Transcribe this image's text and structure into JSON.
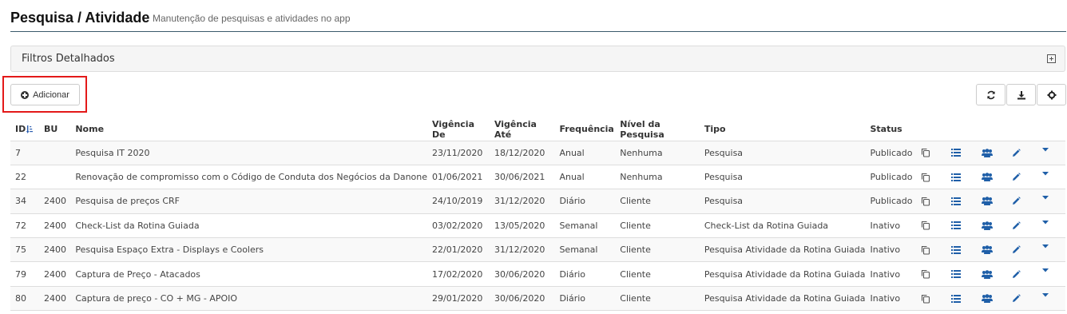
{
  "header": {
    "title": "Pesquisa / Atividade",
    "subtitle": "Manutenção de pesquisas e atividades no app"
  },
  "filters": {
    "title": "Filtros Detalhados"
  },
  "toolbar": {
    "add_label": "Adicionar"
  },
  "table": {
    "columns": [
      "ID",
      "BU",
      "Nome",
      "Vigência De",
      "Vigência Até",
      "Frequência",
      "Nível da Pesquisa",
      "Tipo",
      "Status"
    ],
    "rows": [
      [
        "7",
        "",
        "Pesquisa IT 2020",
        "23/11/2020",
        "18/12/2020",
        "Anual",
        "Nenhuma",
        "Pesquisa",
        "Publicado"
      ],
      [
        "22",
        "",
        "Renovação de compromisso com o Código de Conduta dos Negócios da Danone",
        "01/06/2021",
        "30/06/2021",
        "Anual",
        "Nenhuma",
        "Pesquisa",
        "Publicado"
      ],
      [
        "34",
        "2400",
        "Pesquisa de preços CRF",
        "24/10/2019",
        "31/12/2020",
        "Diário",
        "Cliente",
        "Pesquisa",
        "Publicado"
      ],
      [
        "72",
        "2400",
        "Check-List da Rotina Guiada",
        "03/02/2020",
        "13/05/2020",
        "Semanal",
        "Cliente",
        "Check-List da Rotina Guiada",
        "Inativo"
      ],
      [
        "75",
        "2400",
        "Pesquisa Espaço Extra - Displays e Coolers",
        "22/01/2020",
        "31/12/2020",
        "Semanal",
        "Cliente",
        "Pesquisa Atividade da Rotina Guiada",
        "Inativo"
      ],
      [
        "79",
        "2400",
        "Captura de Preço - Atacados",
        "17/02/2020",
        "30/06/2020",
        "Diário",
        "Cliente",
        "Pesquisa Atividade da Rotina Guiada",
        "Inativo"
      ],
      [
        "80",
        "2400",
        "Captura de preço - CO + MG - APOIO",
        "29/01/2020",
        "30/06/2020",
        "Diário",
        "Cliente",
        "Pesquisa Atividade da Rotina Guiada",
        "Inativo"
      ]
    ]
  },
  "icons": {
    "refresh": "refresh-icon",
    "download": "download-icon",
    "settings": "gear-icon",
    "row_actions": [
      "copy-icon",
      "list-icon",
      "users-icon",
      "pencil-icon",
      "caret-down-icon"
    ]
  },
  "colors": {
    "action_blue": "#1f5fa8",
    "highlight_red": "#e31919",
    "header_rule": "#3b5a6b"
  }
}
